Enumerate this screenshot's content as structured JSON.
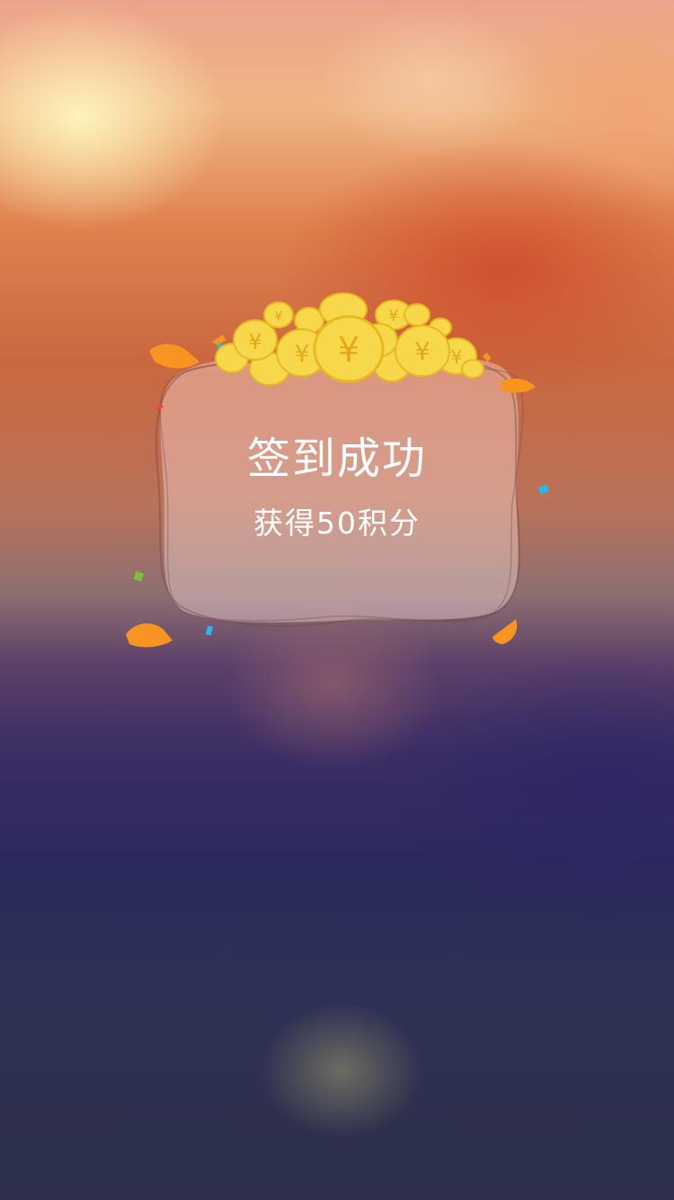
{
  "dialog": {
    "title": "签到成功",
    "subtitle": "获得50积分",
    "coin_symbol": "¥"
  },
  "colors": {
    "coin_fill": "#f7d84a",
    "coin_edge": "#e8b820",
    "confetti_orange": "#f79422",
    "confetti_blue": "#2ab8e8",
    "confetti_green": "#7ac43a",
    "text": "#ffffff"
  },
  "icons": [
    "coin-pile-icon",
    "confetti-icon"
  ]
}
